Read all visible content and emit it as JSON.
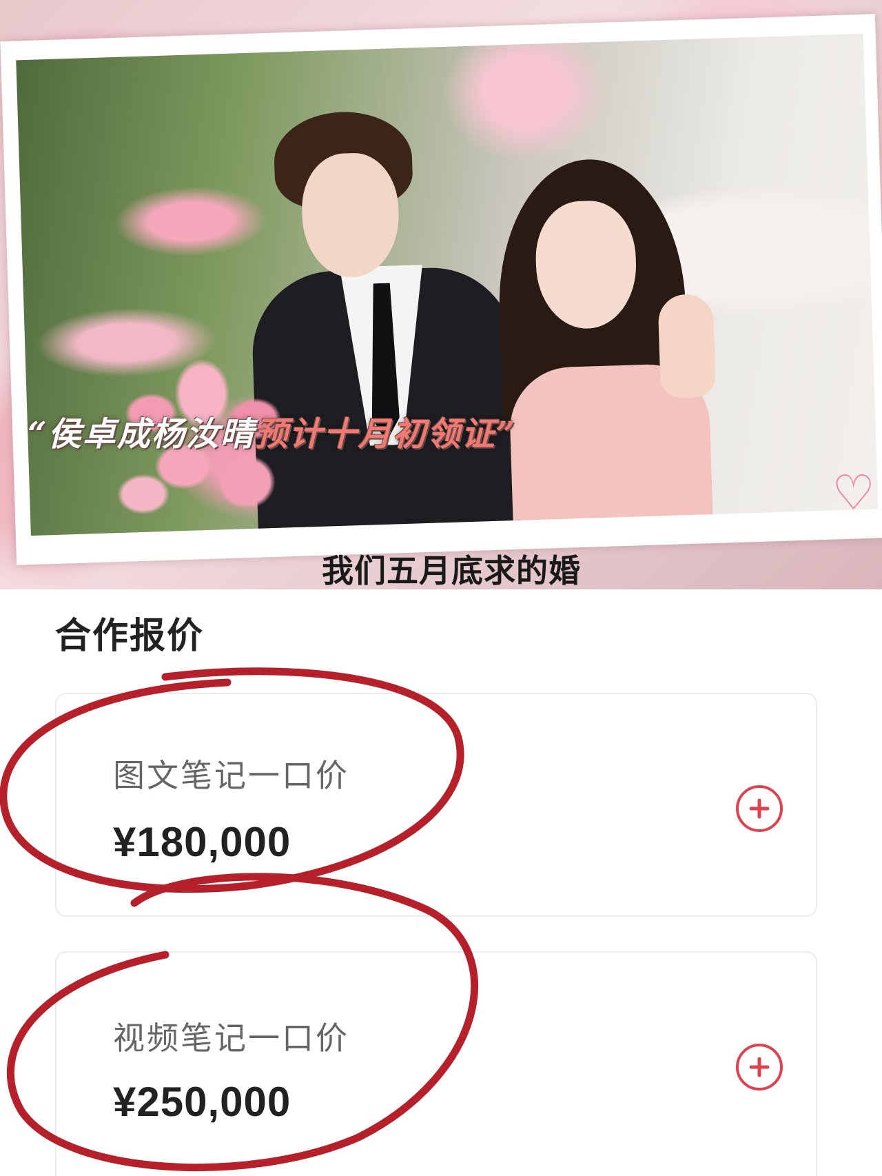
{
  "photo": {
    "headline_part1": "“侯卓成杨汝晴",
    "headline_part2": "预计十月初领证”",
    "subtitle": "我们五月底求的婚"
  },
  "panel": {
    "title": "合作报价",
    "cards": [
      {
        "label": "图文笔记一口价",
        "price": "¥180,000",
        "action_icon": "plus-circle-icon"
      },
      {
        "label": "视频笔记一口价",
        "price": "¥250,000",
        "action_icon": "plus-circle-icon"
      }
    ]
  },
  "colors": {
    "accent_red": "#e0414f",
    "annotation_red": "#b5202a",
    "headline_highlight": "#f07a73"
  }
}
